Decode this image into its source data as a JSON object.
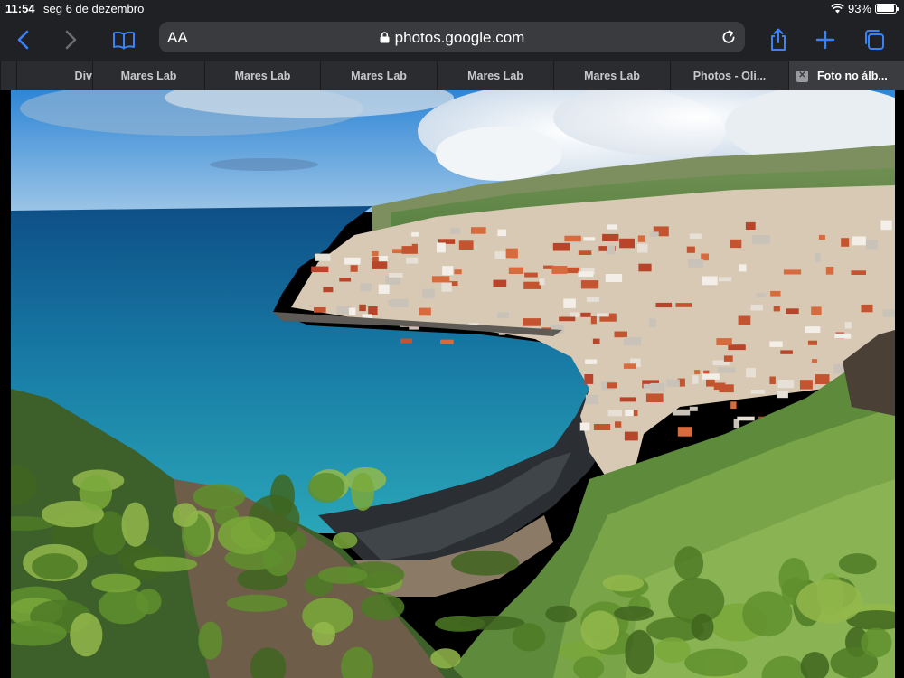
{
  "status": {
    "time": "11:54",
    "date": "seg 6 de dezembro",
    "battery": "93%",
    "battery_level": 0.93
  },
  "toolbar": {
    "text_size_label": "AA",
    "url": "photos.google.com"
  },
  "tabs": [
    {
      "label": ""
    },
    {
      "label": "Div"
    },
    {
      "label": "Mares Lab"
    },
    {
      "label": "Mares Lab"
    },
    {
      "label": "Mares Lab"
    },
    {
      "label": "Mares Lab"
    },
    {
      "label": "Mares Lab"
    },
    {
      "label": "Photos - Oli..."
    },
    {
      "label": "Foto no álb..."
    }
  ],
  "icons": {
    "back": "chevron-left-icon",
    "forward": "chevron-right-icon",
    "bookmarks": "book-icon",
    "lock": "lock-icon",
    "reload": "reload-icon",
    "share": "share-icon",
    "new_tab": "plus-icon",
    "tabs": "tabs-icon",
    "wifi": "wifi-icon",
    "battery": "battery-icon",
    "close_tab": "close-icon"
  },
  "colors": {
    "accent": "#3b82f6",
    "chrome_bg": "#202124",
    "tab_bg": "#2b2c30",
    "active_tab_bg": "#3b3c40"
  }
}
